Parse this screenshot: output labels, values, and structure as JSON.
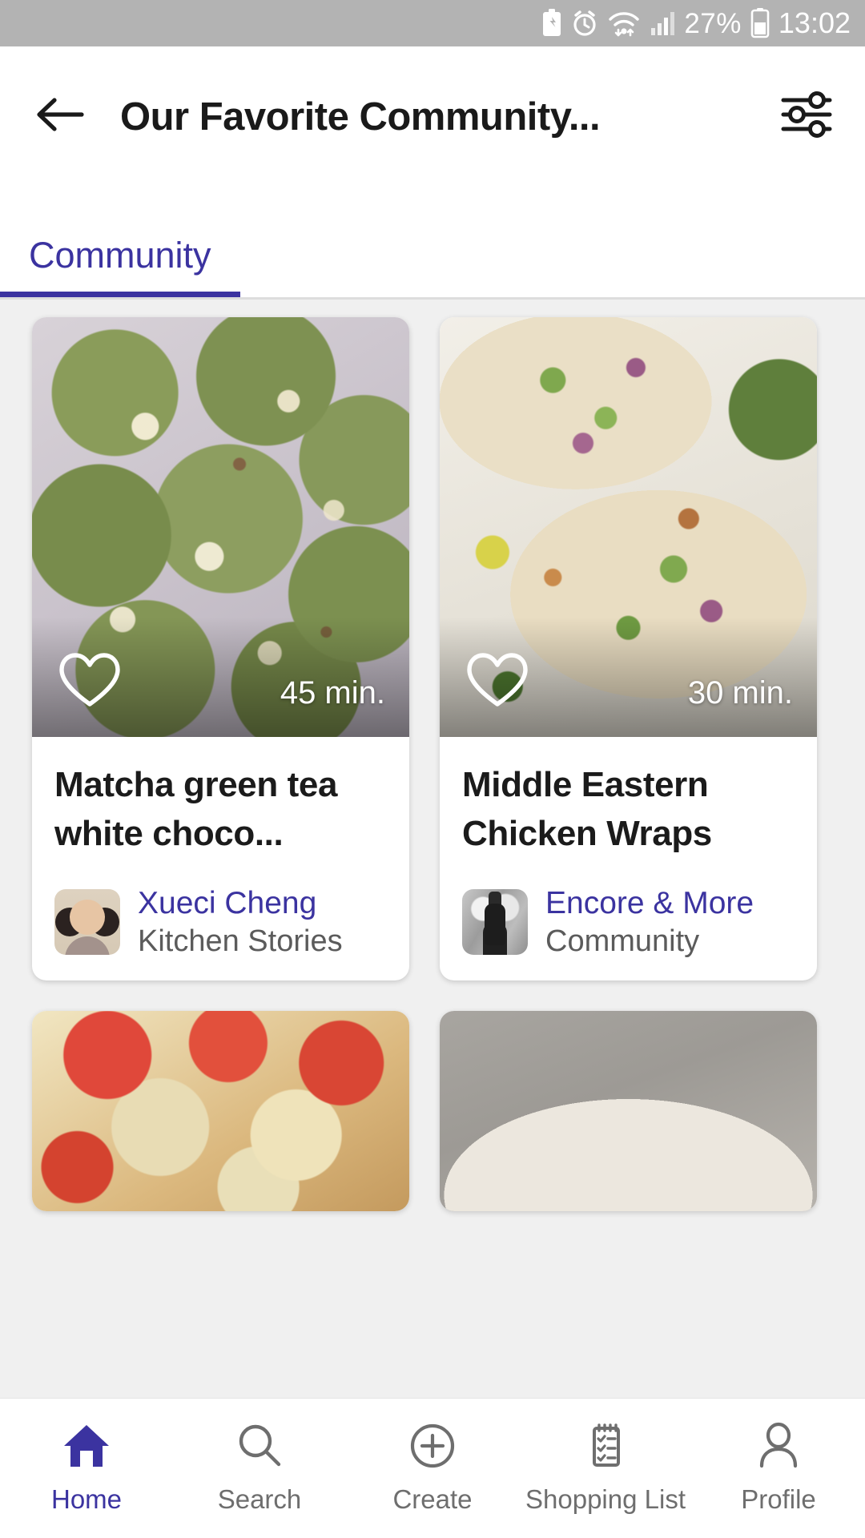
{
  "status_bar": {
    "battery_percent": "27%",
    "time": "13:02",
    "icons": [
      "battery-saver-icon",
      "alarm-icon",
      "wifi-icon",
      "signal-icon",
      "battery-icon"
    ],
    "background": "#b3b3b3",
    "foreground": "#ffffff"
  },
  "header": {
    "back_icon": "back-arrow-icon",
    "title": "Our Favorite Community...",
    "filter_icon": "filter-sliders-icon"
  },
  "tabs": {
    "items": [
      {
        "label": "Community",
        "active": true
      }
    ],
    "accent_color": "#3b33a0"
  },
  "cards": [
    {
      "title": "Matcha green tea white choco...",
      "duration": "45 min.",
      "favorite_icon": "heart-outline-icon",
      "author_name": "Xueci Cheng",
      "author_source": "Kitchen Stories",
      "avatar_name": "avatar-xueci-cheng",
      "image_name": "matcha-cookies-photo"
    },
    {
      "title": "Middle Eastern Chicken Wraps",
      "duration": "30 min.",
      "favorite_icon": "heart-outline-icon",
      "author_name": "Encore & More",
      "author_source": "Community",
      "avatar_name": "avatar-encore-and-more",
      "image_name": "chicken-wraps-photo"
    },
    {
      "title": "",
      "duration": "",
      "favorite_icon": "heart-outline-icon",
      "author_name": "",
      "author_source": "",
      "avatar_name": "",
      "image_name": "tomato-bake-photo"
    },
    {
      "title": "",
      "duration": "",
      "favorite_icon": "heart-outline-icon",
      "author_name": "",
      "author_source": "",
      "avatar_name": "",
      "image_name": "pasta-bowl-photo"
    }
  ],
  "bottom_nav": {
    "items": [
      {
        "label": "Home",
        "icon": "home-icon",
        "active": true
      },
      {
        "label": "Search",
        "icon": "search-icon",
        "active": false
      },
      {
        "label": "Create",
        "icon": "plus-circle-icon",
        "active": false
      },
      {
        "label": "Shopping List",
        "icon": "clipboard-list-icon",
        "active": false
      },
      {
        "label": "Profile",
        "icon": "person-icon",
        "active": false
      }
    ],
    "active_color": "#3b33a0",
    "inactive_color": "#6e6e6e"
  }
}
